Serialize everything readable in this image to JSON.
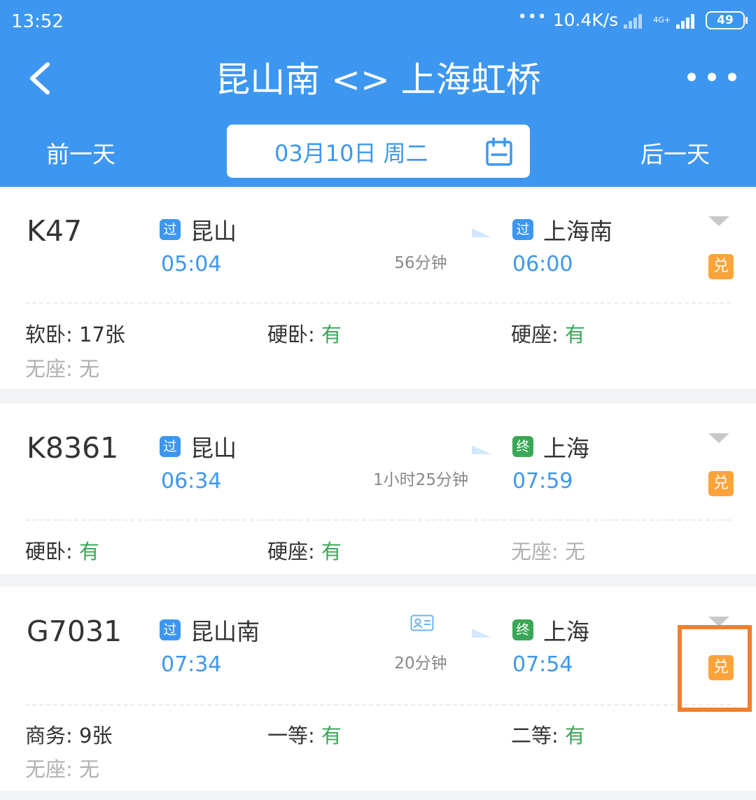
{
  "status_bar": {
    "time": "13:52",
    "dots": "•••",
    "speed": "10.4K/s",
    "network": "4G+",
    "battery": "49"
  },
  "nav": {
    "title": "昆山南 <> 上海虹桥"
  },
  "date_bar": {
    "prev_label": "前一天",
    "date": "03月10日 周二",
    "next_label": "后一天"
  },
  "trains": [
    {
      "number": "K47",
      "from_badge": "过",
      "from_station": "昆山",
      "depart": "05:04",
      "duration": "56分钟",
      "to_badge": "过",
      "to_station": "上海南",
      "arrive": "06:00",
      "exchange_label": "兑",
      "seats": [
        {
          "name": "软卧:",
          "value": "17张"
        },
        {
          "name": "硬卧:",
          "value": "有"
        },
        {
          "name": "硬座:",
          "value": "有"
        },
        {
          "name": "无座:",
          "value": "无"
        }
      ]
    },
    {
      "number": "K8361",
      "from_badge": "过",
      "from_station": "昆山",
      "depart": "06:34",
      "duration": "1小时25分钟",
      "to_badge": "终",
      "to_station": "上海",
      "arrive": "07:59",
      "exchange_label": "兑",
      "seats": [
        {
          "name": "硬卧:",
          "value": "有"
        },
        {
          "name": "硬座:",
          "value": "有"
        },
        {
          "name": "无座:",
          "value": "无"
        }
      ]
    },
    {
      "number": "G7031",
      "from_badge": "过",
      "from_station": "昆山南",
      "depart": "07:34",
      "duration": "20分钟",
      "to_badge": "终",
      "to_station": "上海",
      "arrive": "07:54",
      "exchange_label": "兑",
      "seats": [
        {
          "name": "商务:",
          "value": "9张"
        },
        {
          "name": "一等:",
          "value": "有"
        },
        {
          "name": "二等:",
          "value": "有"
        },
        {
          "name": "无座:",
          "value": "无"
        }
      ]
    }
  ],
  "colors": {
    "brand": "#3d97f0",
    "available": "#3aa757",
    "exchange": "#fda33a",
    "highlight": "#f27f2b"
  }
}
